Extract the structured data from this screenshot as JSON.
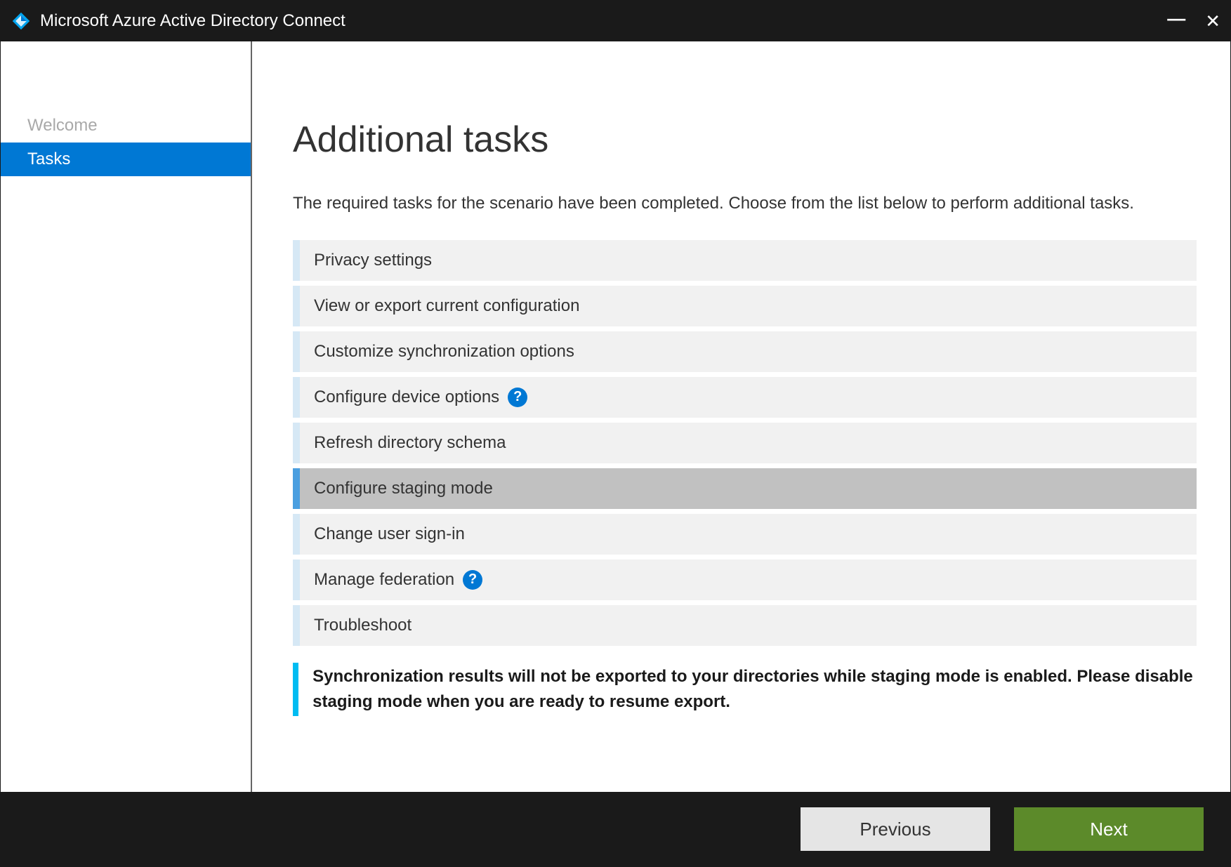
{
  "window": {
    "title": "Microsoft Azure Active Directory Connect"
  },
  "sidebar": {
    "items": [
      {
        "label": "Welcome",
        "active": false
      },
      {
        "label": "Tasks",
        "active": true
      }
    ]
  },
  "page": {
    "title": "Additional tasks",
    "description": "The required tasks for the scenario have been completed. Choose from the list below to perform additional tasks."
  },
  "tasks": [
    {
      "label": "Privacy settings",
      "help": false,
      "selected": false
    },
    {
      "label": "View or export current configuration",
      "help": false,
      "selected": false
    },
    {
      "label": "Customize synchronization options",
      "help": false,
      "selected": false
    },
    {
      "label": "Configure device options",
      "help": true,
      "selected": false
    },
    {
      "label": "Refresh directory schema",
      "help": false,
      "selected": false
    },
    {
      "label": "Configure staging mode",
      "help": false,
      "selected": true
    },
    {
      "label": "Change user sign-in",
      "help": false,
      "selected": false
    },
    {
      "label": "Manage federation",
      "help": true,
      "selected": false
    },
    {
      "label": "Troubleshoot",
      "help": false,
      "selected": false
    }
  ],
  "note": {
    "text": "Synchronization results will not be exported to your directories while staging mode is enabled. Please disable staging mode when you are ready to resume export."
  },
  "footer": {
    "previous_label": "Previous",
    "next_label": "Next"
  },
  "icons": {
    "help_glyph": "?"
  }
}
